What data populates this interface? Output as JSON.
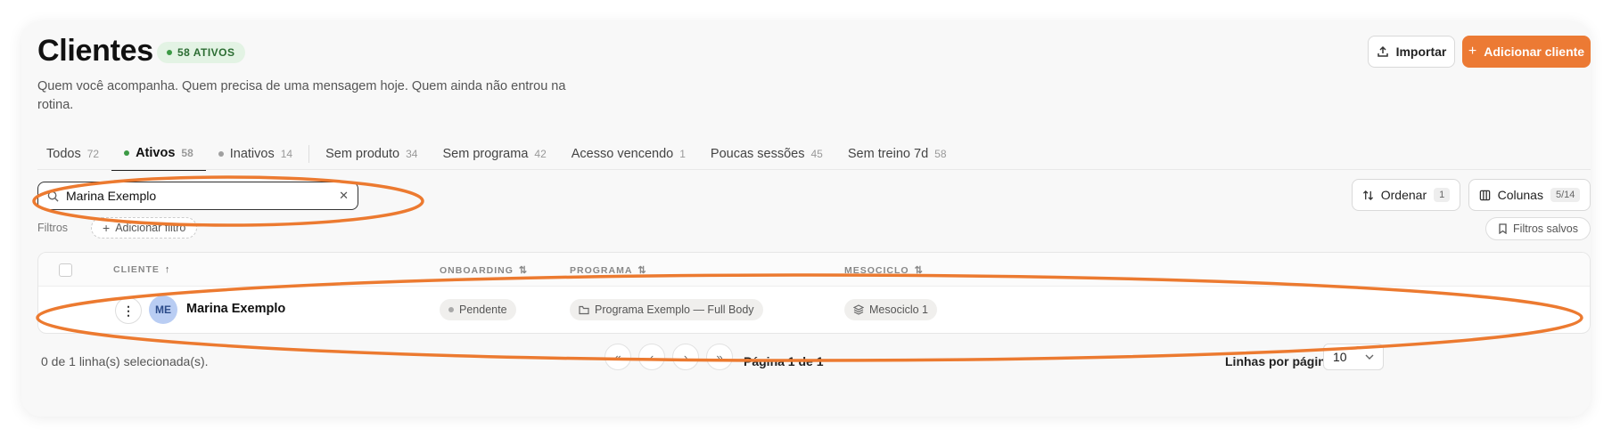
{
  "header": {
    "title": "Clientes",
    "badge": "58 ATIVOS",
    "subtitle": "Quem você acompanha. Quem precisa de uma mensagem hoje. Quem ainda não entrou na rotina.",
    "import_label": "Importar",
    "add_label": "Adicionar cliente"
  },
  "tabs": [
    {
      "label": "Todos",
      "count": "72"
    },
    {
      "label": "Ativos",
      "count": "58"
    },
    {
      "label": "Inativos",
      "count": "14"
    },
    {
      "label": "Sem produto",
      "count": "34"
    },
    {
      "label": "Sem programa",
      "count": "42"
    },
    {
      "label": "Acesso vencendo",
      "count": "1"
    },
    {
      "label": "Poucas sessões",
      "count": "45"
    },
    {
      "label": "Sem treino 7d",
      "count": "58"
    }
  ],
  "toolbar": {
    "search_value": "Marina Exemplo",
    "sort_label": "Ordenar",
    "sort_count": "1",
    "columns_label": "Colunas",
    "columns_count": "5/14",
    "filters_label": "Filtros",
    "add_filter_label": "Adicionar filtro",
    "saved_filters_label": "Filtros salvos"
  },
  "table": {
    "headers": {
      "client": "CLIENTE",
      "onboarding": "ONBOARDING",
      "program": "PROGRAMA",
      "mesocycle": "MESOCICLO"
    },
    "rows": [
      {
        "initials": "ME",
        "name": "Marina Exemplo",
        "onboarding": "Pendente",
        "program": "Programa Exemplo — Full Body",
        "mesocycle": "Mesociclo 1"
      }
    ]
  },
  "footer": {
    "selected_text": "0 de 1 linha(s) selecionada(s).",
    "page_text": "Página 1 de 1",
    "rows_per_page_label": "Linhas por página",
    "rows_per_page_value": "10"
  },
  "colors": {
    "accent": "#ec7a34",
    "active_dot": "#3c9a45",
    "inactive_dot": "#a0a0a0"
  }
}
